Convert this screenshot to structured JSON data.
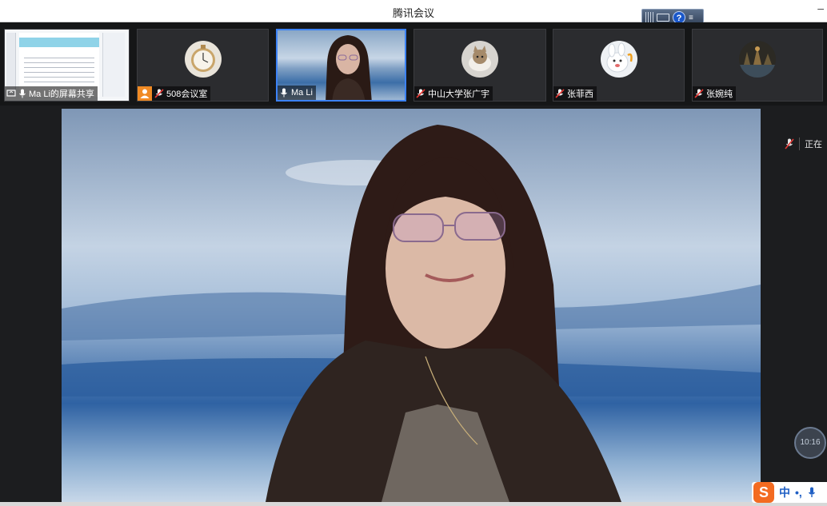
{
  "window": {
    "title": "腾讯会议",
    "minimize_glyph": "–"
  },
  "ime_toolbar": {
    "help_glyph": "?",
    "options_glyph": "≡"
  },
  "participants": [
    {
      "name": "Ma Li的屏幕共享",
      "type": "screen-share",
      "icon": "screen-share-icon"
    },
    {
      "name": "508会议室",
      "type": "avatar",
      "mic": "muted",
      "badge": "room-badge-icon",
      "avatar_icon": "pocket-watch-icon"
    },
    {
      "name": "Ma Li",
      "type": "video",
      "mic": "on",
      "active": true
    },
    {
      "name": "中山大学张广宇",
      "type": "avatar",
      "mic": "muted",
      "avatar_icon": "cat-avatar-icon"
    },
    {
      "name": "张菲西",
      "type": "avatar",
      "mic": "muted",
      "avatar_icon": "cartoon-avatar-icon"
    },
    {
      "name": "张婉纯",
      "type": "avatar",
      "mic": "muted",
      "avatar_icon": "scenery-avatar-icon"
    }
  ],
  "speaking_panel": {
    "label": "正在"
  },
  "timer": {
    "text": "10:16"
  },
  "ime_bar": {
    "logo": "S",
    "mode": "中",
    "punct": "•,",
    "mic_icon": "mic-icon"
  },
  "colors": {
    "active_border": "#3c82f6",
    "accent_orange": "#f36b21",
    "ime_blue": "#1f5fc4"
  }
}
